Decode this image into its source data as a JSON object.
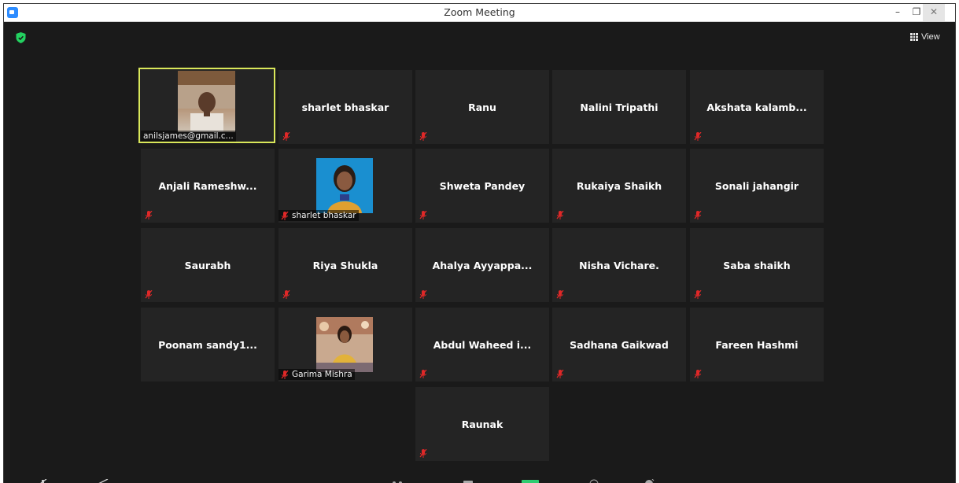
{
  "window": {
    "title": "Zoom Meeting"
  },
  "controls": {
    "minimize": "–",
    "restore": "❐",
    "close": "✕"
  },
  "top_bar": {
    "view_label": "View"
  },
  "active_speaker": {
    "caption": "anilsjames@gmail.c..."
  },
  "participants": [
    {
      "name": "sharlet bhaskar"
    },
    {
      "name": "Ranu"
    },
    {
      "name": "Nalini Tripathi"
    },
    {
      "name": "Akshata  kalamb..."
    },
    {
      "name": "Anjali  Rameshw..."
    },
    {
      "name": "sharlet bhaskar"
    },
    {
      "name": "Shweta Pandey"
    },
    {
      "name": "Rukaiya Shaikh"
    },
    {
      "name": "Sonali jahangir"
    },
    {
      "name": "Saurabh"
    },
    {
      "name": "Riya Shukla"
    },
    {
      "name": "Ahalya  Ayyappa..."
    },
    {
      "name": "Nisha Vichare."
    },
    {
      "name": "Saba shaikh"
    },
    {
      "name": "Poonam  sandy1..."
    },
    {
      "name": "Garima Mishra"
    },
    {
      "name": "Abdul  Waheed  i..."
    },
    {
      "name": "Sadhana Gaikwad"
    },
    {
      "name": "Fareen Hashmi"
    },
    {
      "name": "Raunak"
    }
  ],
  "colors": {
    "active_border": "#d9e75a",
    "tile_bg": "#242424",
    "mute_red": "#e02828",
    "shield_green": "#23d160"
  }
}
